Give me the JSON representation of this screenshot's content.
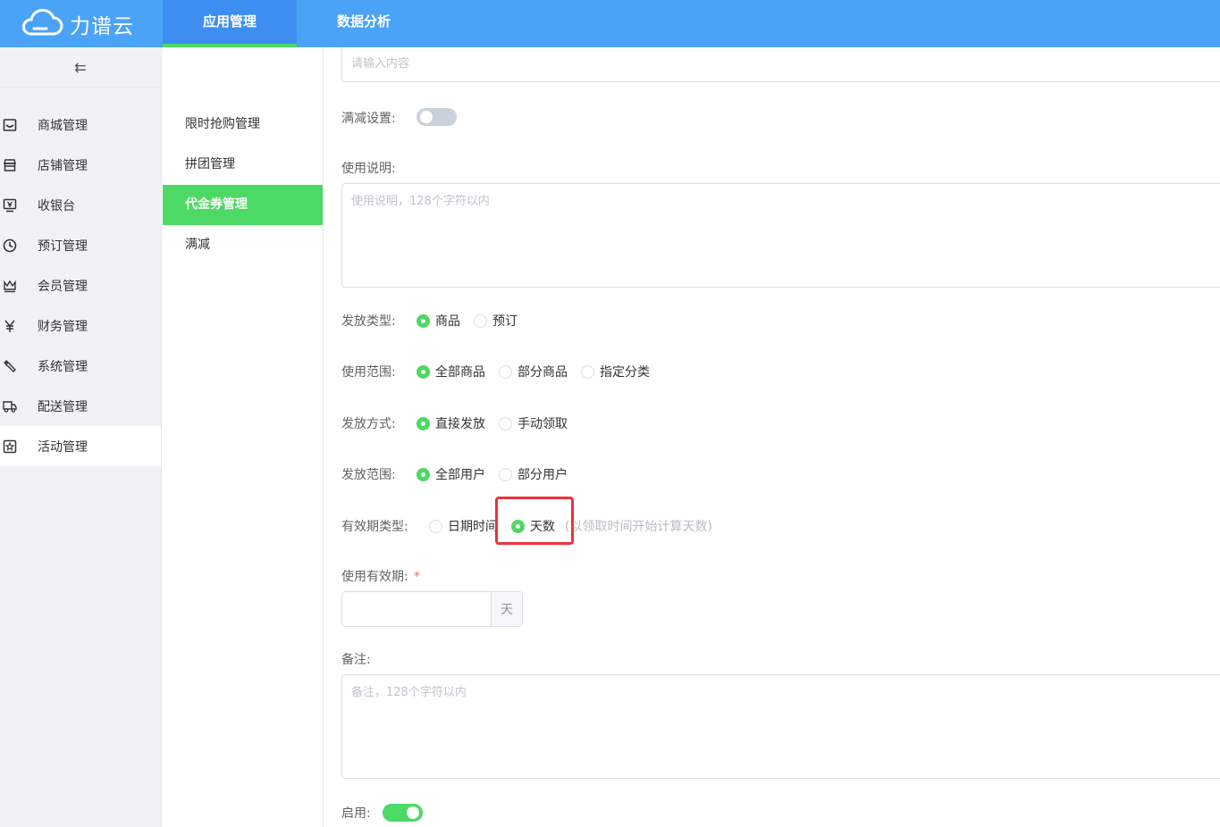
{
  "header": {
    "logo_text": "力谱云",
    "tabs": [
      {
        "label": "应用管理"
      },
      {
        "label": "数据分析"
      }
    ]
  },
  "sidebar": {
    "collapse_glyph": "⇇",
    "items": [
      {
        "label": "商城管理",
        "icon": "store-icon"
      },
      {
        "label": "店铺管理",
        "icon": "shop-icon"
      },
      {
        "label": "收银台",
        "icon": "cashier-icon"
      },
      {
        "label": "预订管理",
        "icon": "clock-icon"
      },
      {
        "label": "会员管理",
        "icon": "crown-icon"
      },
      {
        "label": "财务管理",
        "icon": "yen-icon"
      },
      {
        "label": "系统管理",
        "icon": "wrench-icon"
      },
      {
        "label": "配送管理",
        "icon": "truck-icon"
      },
      {
        "label": "活动管理",
        "icon": "activity-icon"
      }
    ]
  },
  "subnav": {
    "items": [
      {
        "label": "限时抢购管理"
      },
      {
        "label": "拼团管理"
      },
      {
        "label": "代金券管理"
      },
      {
        "label": "满减"
      }
    ]
  },
  "form": {
    "top_input_placeholder": "请输入内容",
    "full_reduction_label": "满减设置:",
    "usage_desc_label": "使用说明:",
    "usage_desc_placeholder": "使用说明，128个字符以内",
    "issue_type": {
      "label": "发放类型:",
      "options": [
        "商品",
        "预订"
      ],
      "selected": "商品"
    },
    "scope": {
      "label": "使用范围:",
      "options": [
        "全部商品",
        "部分商品",
        "指定分类"
      ],
      "selected": "全部商品"
    },
    "issue_method": {
      "label": "发放方式:",
      "options": [
        "直接发放",
        "手动领取"
      ],
      "selected": "直接发放"
    },
    "issue_range": {
      "label": "发放范围:",
      "options": [
        "全部用户",
        "部分用户"
      ],
      "selected": "全部用户"
    },
    "validity_type": {
      "label": "有效期类型:",
      "options": [
        "日期时间",
        "天数"
      ],
      "selected": "天数",
      "hint": "(以领取时间开始计算天数)"
    },
    "validity_period": {
      "label": "使用有效期:",
      "required_mark": "*",
      "unit": "天"
    },
    "remark_label": "备注:",
    "remark_placeholder": "备注，128个字符以内",
    "enable_label": "启用:"
  },
  "colors": {
    "header": "#4aa3f7",
    "accent_green": "#4cd964",
    "highlight_red": "#f0313a"
  }
}
